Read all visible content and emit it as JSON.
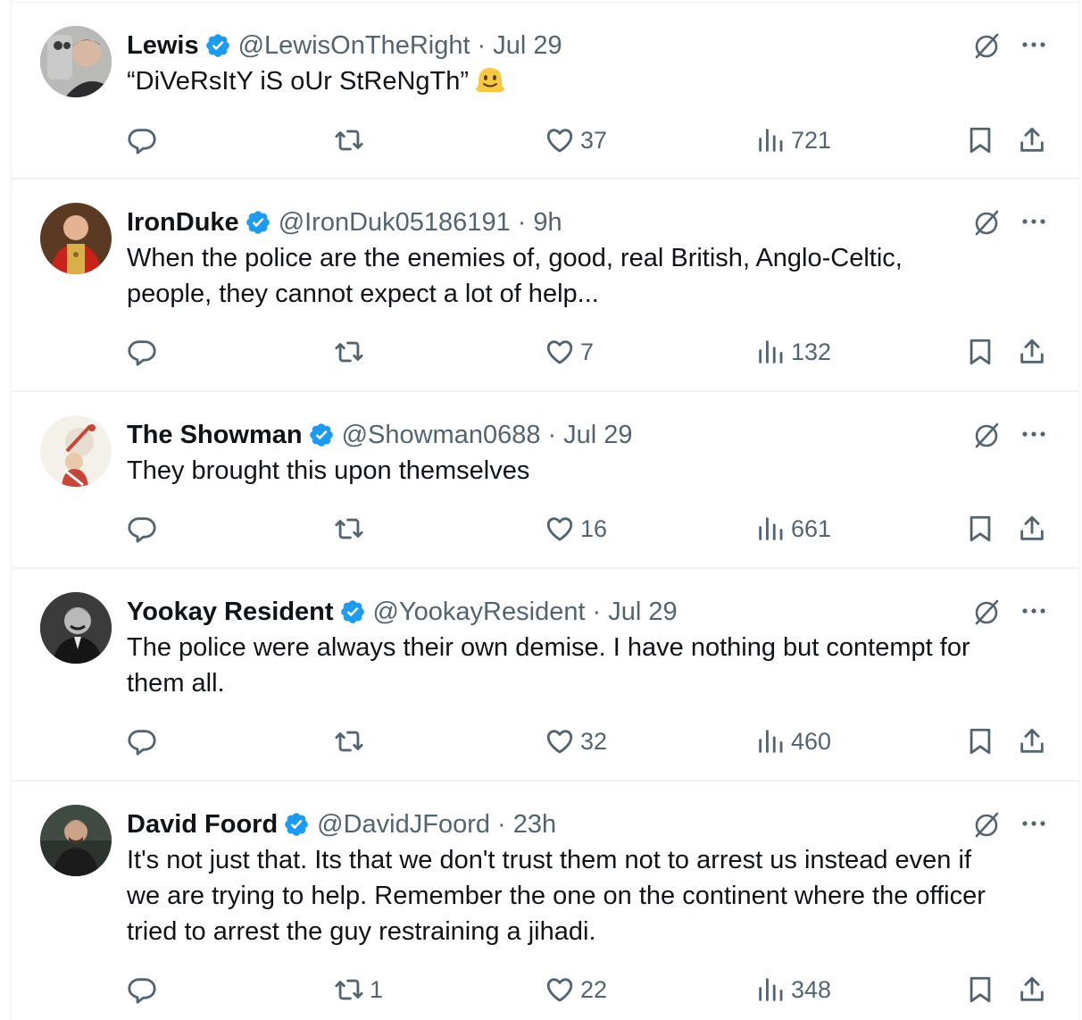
{
  "tweets": [
    {
      "name": "Lewis",
      "handle": "@LewisOnTheRight",
      "time": "Jul 29",
      "text": "“DiVeRsItY iS oUr StReNgTh”",
      "emoji": "melting-face-emoji",
      "stats": {
        "replies": "",
        "retweets": "",
        "likes": "37",
        "views": "721"
      }
    },
    {
      "name": "IronDuke",
      "handle": "@IronDuk05186191",
      "time": "9h",
      "text_lines": [
        "When the police are the enemies of, good,  real British, Anglo-Celtic,",
        "people, they cannot expect a lot of help..."
      ],
      "stats": {
        "replies": "",
        "retweets": "",
        "likes": "7",
        "views": "132"
      }
    },
    {
      "name": "The Showman",
      "handle": "@Showman0688",
      "time": "Jul 29",
      "text": "They brought this upon themselves",
      "stats": {
        "replies": "",
        "retweets": "",
        "likes": "16",
        "views": "661"
      }
    },
    {
      "name": "Yookay Resident",
      "handle": "@YookayResident",
      "time": "Jul 29",
      "text_lines": [
        "The police were always their own demise. I have nothing but contempt for",
        "them all."
      ],
      "stats": {
        "replies": "",
        "retweets": "",
        "likes": "32",
        "views": "460"
      }
    },
    {
      "name": "David Foord",
      "handle": "@DavidJFoord",
      "time": "23h",
      "text_lines": [
        "It's not just that. Its that we don't trust them not to arrest us instead even if",
        "we are trying to help. Remember the one on the continent where the officer",
        "tried to arrest the guy restraining a jihadi."
      ],
      "stats": {
        "replies": "",
        "retweets": "1",
        "likes": "22",
        "views": "348"
      }
    }
  ],
  "separator": "·",
  "colors": {
    "text": "#0f1419",
    "secondary": "#536471",
    "verified": "#1d9bf0",
    "divider": "#eff3f4"
  },
  "icons": [
    "verified-badge-icon",
    "grok-icon",
    "more-icon",
    "reply-icon",
    "retweet-icon",
    "like-icon",
    "views-icon",
    "bookmark-icon",
    "share-icon"
  ]
}
